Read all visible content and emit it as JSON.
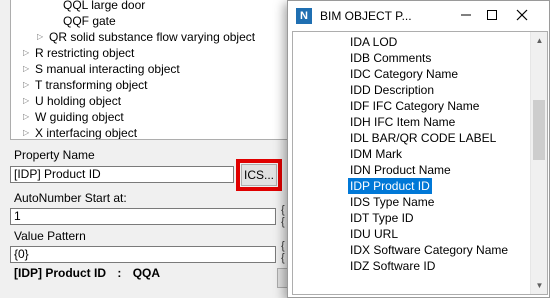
{
  "tree": {
    "items": [
      {
        "label": "QQL large door",
        "indent": 2
      },
      {
        "label": "QQF gate",
        "indent": 2
      },
      {
        "label": "QR solid substance flow varying object",
        "indent": 1
      },
      {
        "label": "R restricting object",
        "indent": 0
      },
      {
        "label": "S manual interacting object",
        "indent": 0
      },
      {
        "label": "T transforming object",
        "indent": 0
      },
      {
        "label": "U holding object",
        "indent": 0
      },
      {
        "label": "W guiding object",
        "indent": 0
      },
      {
        "label": "X interfacing object",
        "indent": 0
      }
    ]
  },
  "property_name": {
    "label": "Property Name",
    "value": "[IDP] Product ID",
    "button_label": "ICS..."
  },
  "autonumber": {
    "label": "AutoNumber Start at:",
    "value": "1"
  },
  "value_pattern": {
    "label": "Value Pattern",
    "value": "{0}"
  },
  "summary": {
    "name": "[IDP] Product ID",
    "separator": ":",
    "value": "QQA"
  },
  "dialog": {
    "title": "BIM OBJECT P...",
    "icon_letter": "N",
    "selected_index": 9,
    "items": [
      "IDA LOD",
      "IDB Comments",
      "IDC Category Name",
      "IDD Description",
      "IDF IFC  Category Name",
      "IDH IFC Item Name",
      "IDL BAR/QR CODE LABEL",
      "IDM Mark",
      "IDN Product Name",
      "IDP Product ID",
      "IDS Type Name",
      "IDT Type ID",
      "IDU URL",
      "IDX Software Category Name",
      "IDZ Software ID"
    ]
  },
  "colors": {
    "highlight": "#e00000",
    "selection": "#0078d7"
  }
}
